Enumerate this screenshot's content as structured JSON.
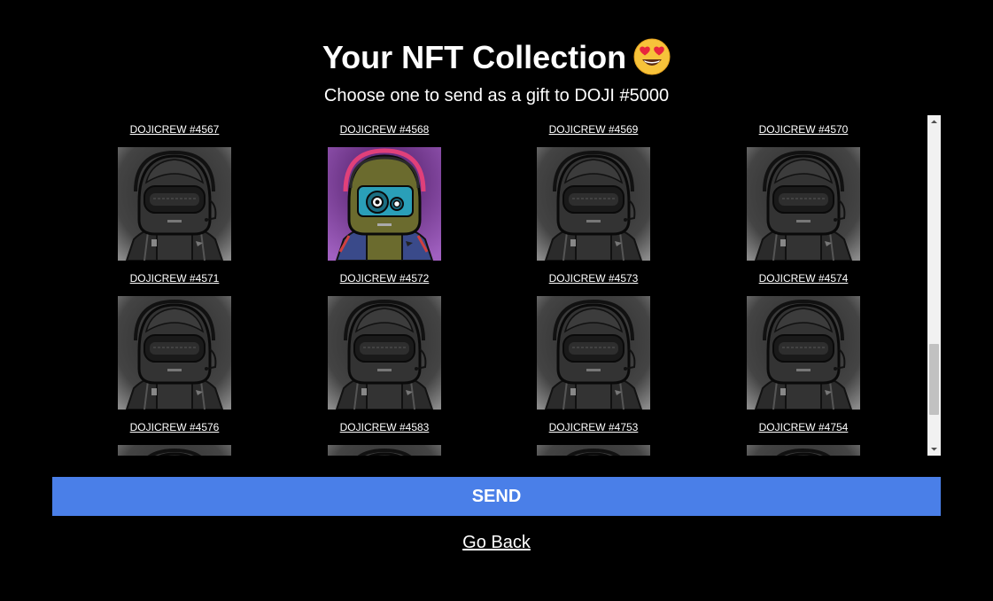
{
  "header": {
    "title": "Your NFT Collection",
    "title_emoji_icon": "heart-eyes-emoji-icon",
    "subtitle": "Choose one to send as a gift to DOJI #5000"
  },
  "collection": {
    "items": [
      {
        "label": "DOJICREW #4567",
        "variant": "gray-robot"
      },
      {
        "label": "DOJICREW #4568",
        "variant": "olive-robot-gears"
      },
      {
        "label": "DOJICREW #4569",
        "variant": "gray-robot"
      },
      {
        "label": "DOJICREW #4570",
        "variant": "gray-robot"
      },
      {
        "label": "DOJICREW #4571",
        "variant": "gray-robot"
      },
      {
        "label": "DOJICREW #4572",
        "variant": "gray-robot"
      },
      {
        "label": "DOJICREW #4573",
        "variant": "gray-robot"
      },
      {
        "label": "DOJICREW #4574",
        "variant": "gray-robot"
      },
      {
        "label": "DOJICREW #4576",
        "variant": "gray-robot"
      },
      {
        "label": "DOJICREW #4583",
        "variant": "gray-robot"
      },
      {
        "label": "DOJICREW #4753",
        "variant": "gray-robot"
      },
      {
        "label": "DOJICREW #4754",
        "variant": "gray-robot"
      }
    ]
  },
  "actions": {
    "send_label": "SEND",
    "go_back_label": "Go Back"
  },
  "colors": {
    "background": "#000000",
    "send_button": "#4a7fe8",
    "text": "#ffffff"
  }
}
